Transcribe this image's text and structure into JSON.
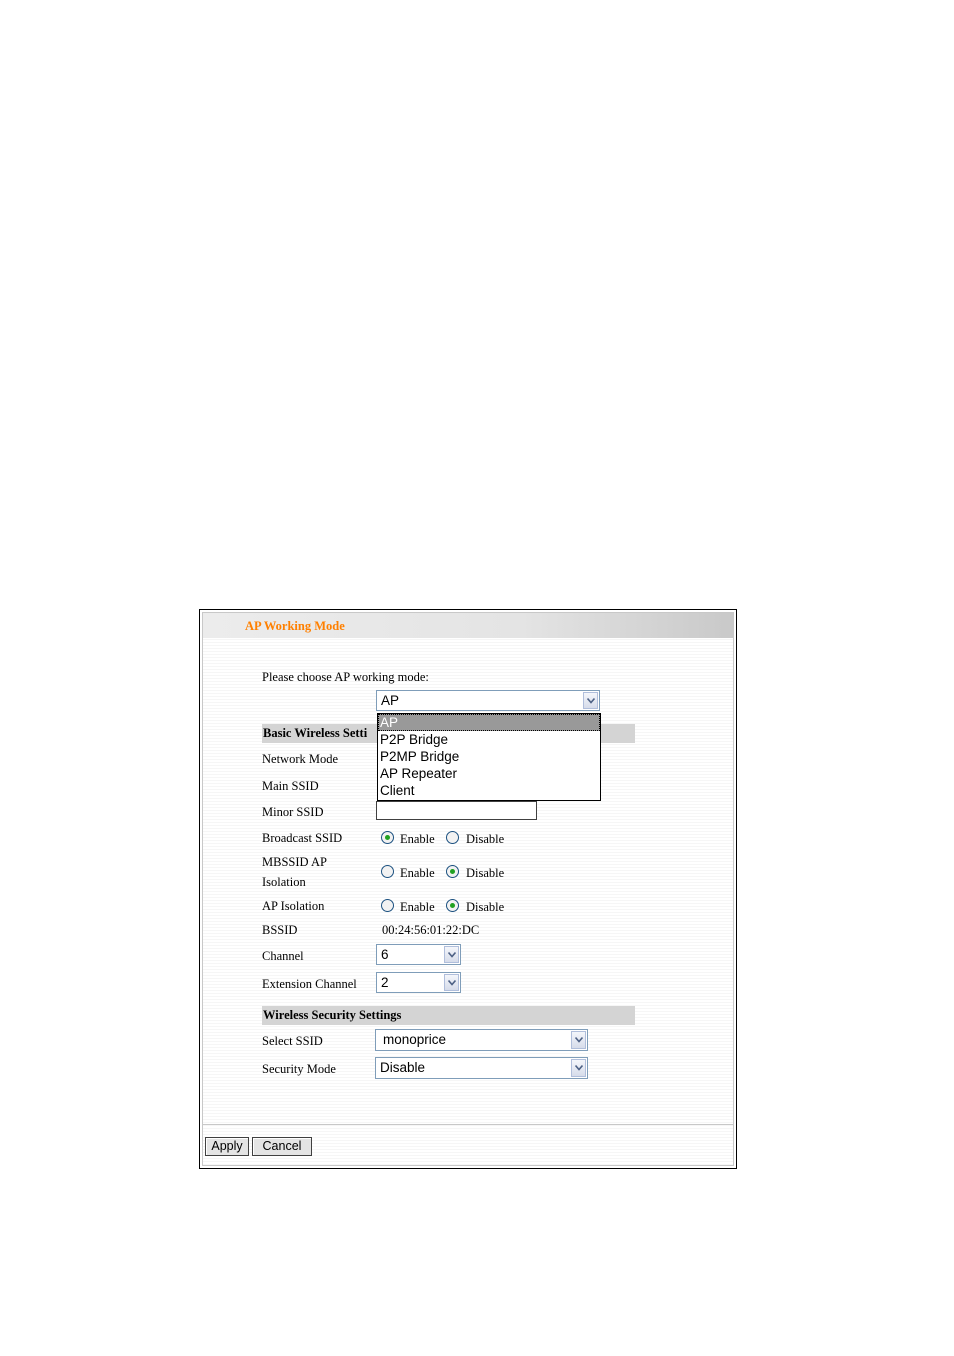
{
  "title": "AP Working Mode",
  "prompt": "Please choose AP working mode:",
  "mode_select": {
    "value": "AP",
    "options": [
      "AP",
      "P2P Bridge",
      "P2MP Bridge",
      "AP Repeater",
      "Client"
    ],
    "selected_index": 0
  },
  "basic_section": {
    "heading": "Basic Wireless Setti",
    "network_mode_label": "Network Mode",
    "main_ssid_label": "Main SSID",
    "minor_ssid_label": "Minor SSID",
    "minor_ssid_value": "",
    "broadcast_ssid_label": "Broadcast SSID",
    "mbssid_label_line1": "MBSSID AP",
    "mbssid_label_line2": "Isolation",
    "ap_isolation_label": "AP Isolation",
    "bssid_label": "BSSID",
    "bssid_value": "00:24:56:01:22:DC",
    "channel_label": "Channel",
    "channel_value": "6",
    "ext_channel_label": "Extension Channel",
    "ext_channel_value": "2"
  },
  "radio_labels": {
    "enable": "Enable",
    "disable": "Disable"
  },
  "radio_state": {
    "broadcast_ssid": "Enable",
    "mbssid_isolation": "Disable",
    "ap_isolation": "Disable"
  },
  "security_section": {
    "heading": "Wireless Security Settings",
    "select_ssid_label": "Select SSID",
    "select_ssid_value": "monoprice",
    "security_mode_label": "Security Mode",
    "security_mode_value": "Disable"
  },
  "buttons": {
    "apply": "Apply",
    "cancel": "Cancel"
  },
  "icons": {
    "dropdown_arrow": "chevron-down-icon"
  },
  "colors": {
    "title": "#ff8000",
    "radio_dot": "#21a121",
    "section_bg": "#d4d4d4"
  }
}
